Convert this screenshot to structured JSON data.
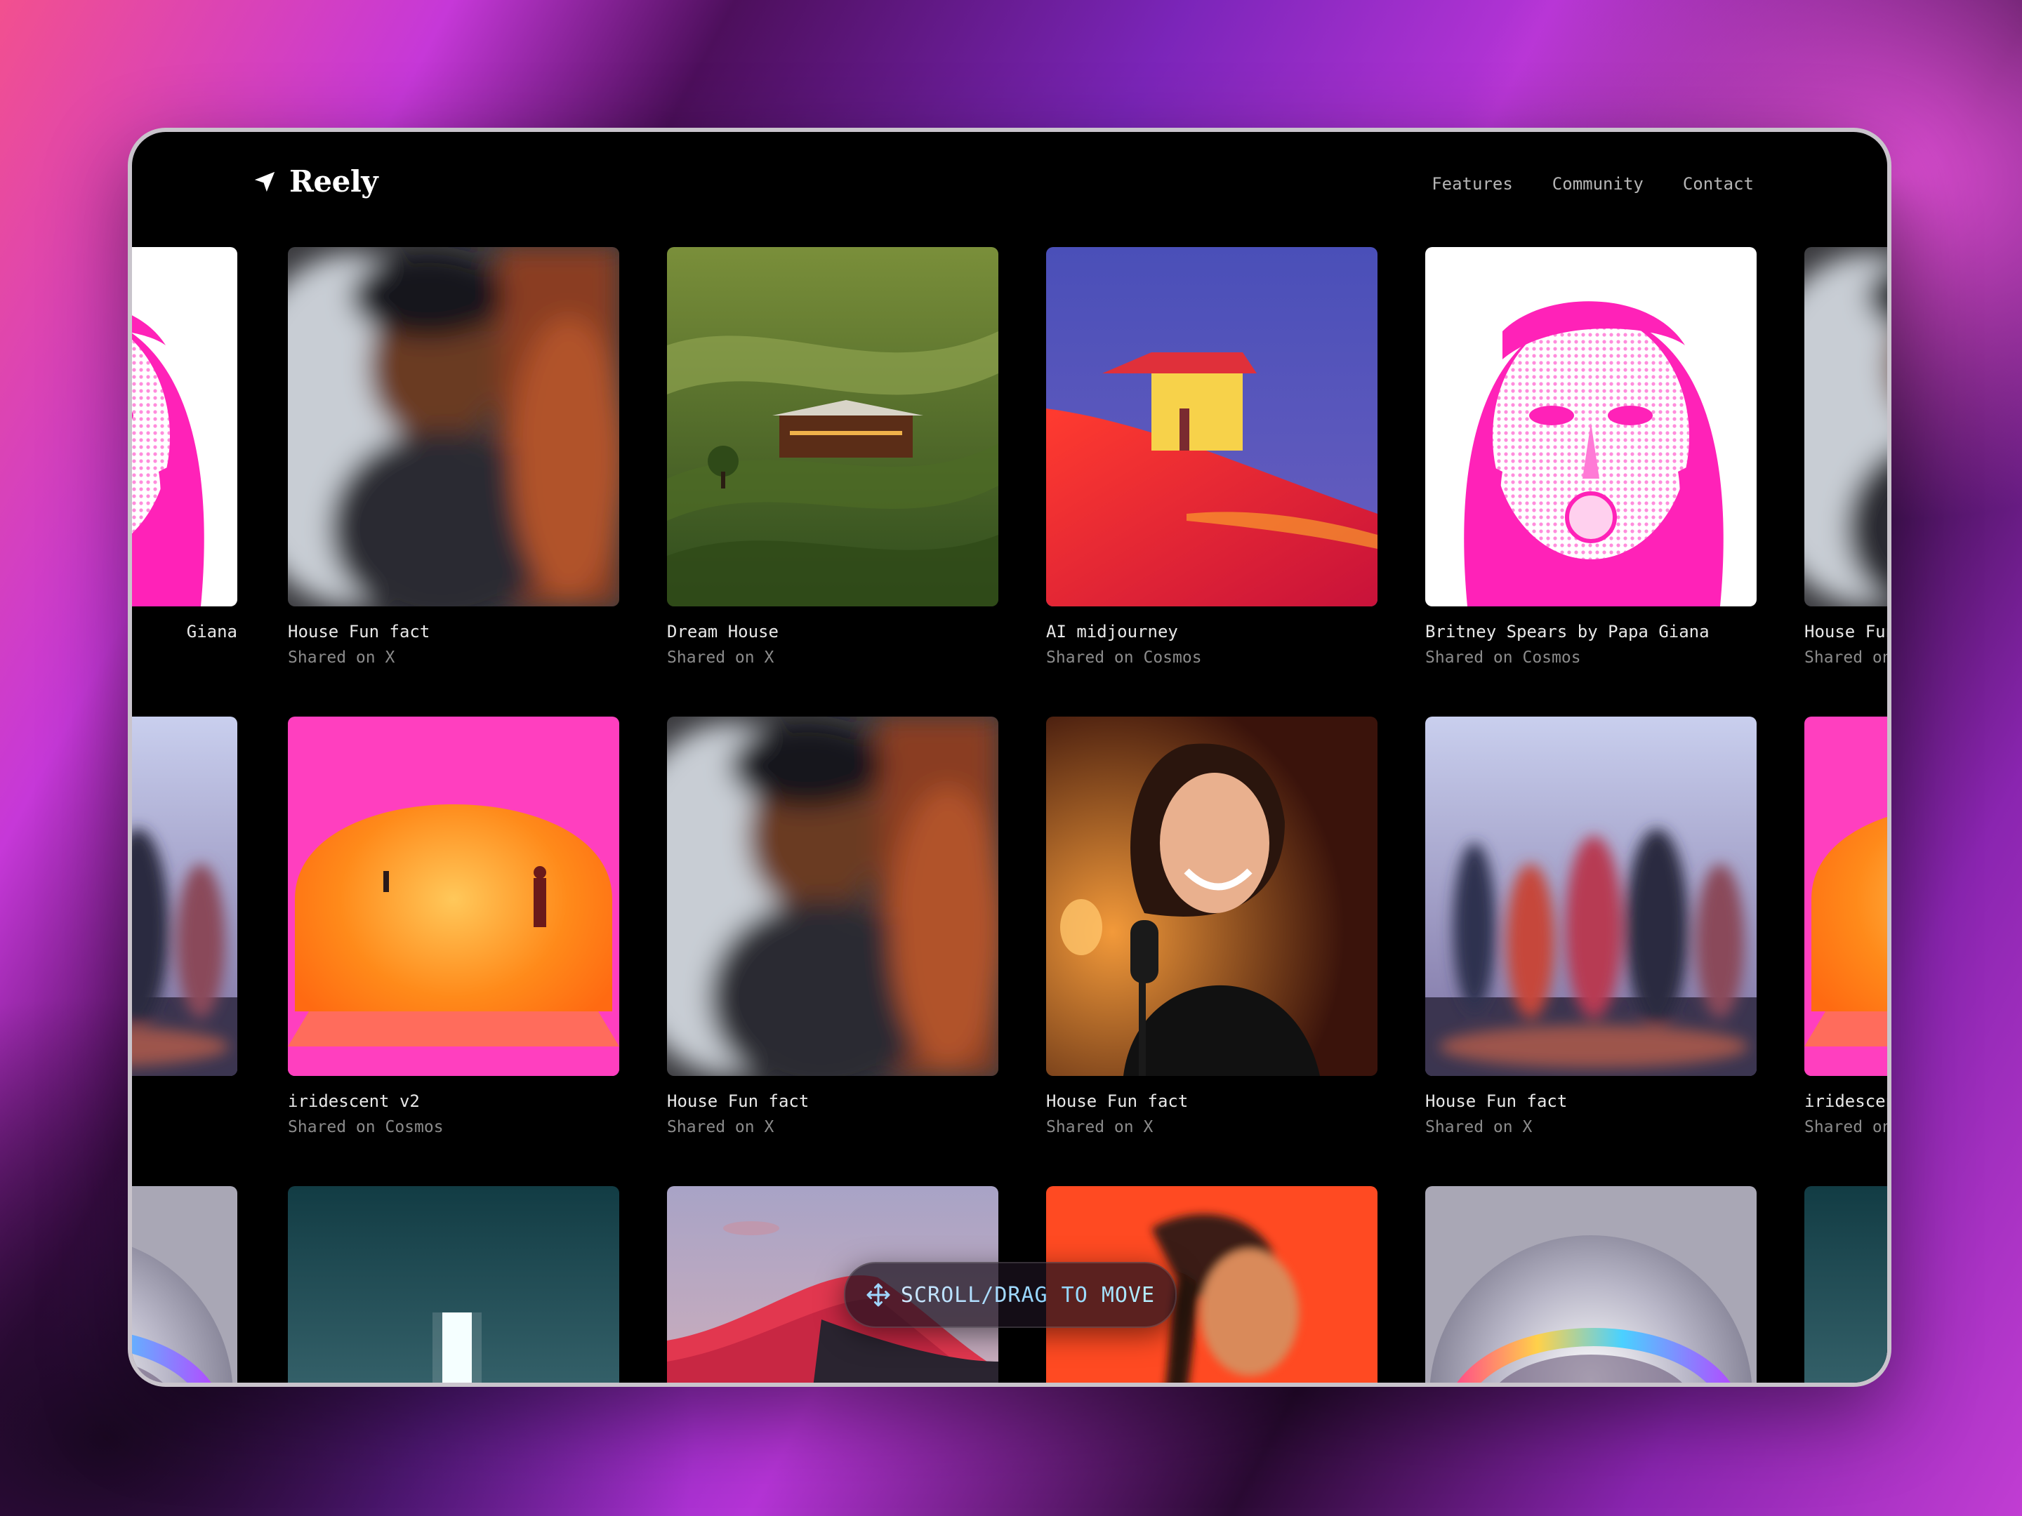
{
  "brand": {
    "name": "Reely",
    "logo_icon": "paper-plane-icon"
  },
  "nav": [
    {
      "label": "Features"
    },
    {
      "label": "Community"
    },
    {
      "label": "Contact"
    }
  ],
  "rows": [
    [
      {
        "title": "Giana",
        "subtitle": "",
        "image": "pink-halftone-portrait"
      },
      {
        "title": "House Fun fact",
        "subtitle": "Shared on X",
        "image": "motion-blur-man"
      },
      {
        "title": "Dream House",
        "subtitle": "Shared on X",
        "image": "cabin-on-green-hills"
      },
      {
        "title": "AI midjourney",
        "subtitle": "Shared on Cosmos",
        "image": "yellow-house-red-field"
      },
      {
        "title": "Britney Spears by Papa Giana",
        "subtitle": "Shared on Cosmos",
        "image": "pink-halftone-portrait"
      },
      {
        "title": "House Fun",
        "subtitle": "Shared on",
        "image": "motion-blur-man"
      }
    ],
    [
      {
        "title": "",
        "subtitle": "",
        "image": "blurred-walkers"
      },
      {
        "title": "iridescent v2",
        "subtitle": "Shared on Cosmos",
        "image": "orange-sun-arch"
      },
      {
        "title": "House Fun fact",
        "subtitle": "Shared on X",
        "image": "motion-blur-man"
      },
      {
        "title": "House Fun fact",
        "subtitle": "Shared on X",
        "image": "woman-podcast-mic"
      },
      {
        "title": "House Fun fact",
        "subtitle": "Shared on X",
        "image": "blurred-walkers"
      },
      {
        "title": "iridescen",
        "subtitle": "Shared on",
        "image": "orange-sun-arch"
      }
    ],
    [
      {
        "title": "",
        "subtitle": "",
        "image": "chrome-helmet"
      },
      {
        "title": "",
        "subtitle": "",
        "image": "teal-monolith"
      },
      {
        "title": "",
        "subtitle": "",
        "image": "pink-dunes"
      },
      {
        "title": "",
        "subtitle": "",
        "image": "orange-portrait"
      },
      {
        "title": "",
        "subtitle": "",
        "image": "chrome-helmet"
      },
      {
        "title": "",
        "subtitle": "",
        "image": "teal-monolith"
      }
    ]
  ],
  "hint": {
    "text": "SCROLL/DRAG TO MOVE",
    "icon": "move-arrows-icon"
  }
}
